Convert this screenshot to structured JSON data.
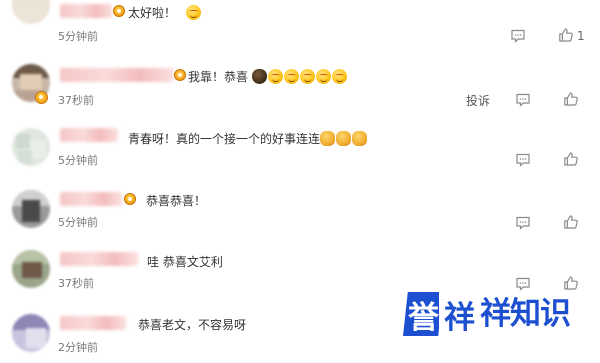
{
  "comments": [
    {
      "text": "太好啦！",
      "emojis": [
        "starstruck"
      ],
      "time": "5分钟前",
      "like_count": "1",
      "show_report": false
    },
    {
      "text": "我靠！恭喜",
      "emojis": [
        "dark",
        "starstruck",
        "starstruck",
        "starstruck",
        "starstruck",
        "starstruck"
      ],
      "time": "37秒前",
      "like_count": "",
      "show_report": true
    },
    {
      "text": "青春呀！真的一个接一个的好事连连",
      "emojis": [
        "clap",
        "clap",
        "clap"
      ],
      "time": "5分钟前",
      "like_count": "",
      "show_report": false
    },
    {
      "text": "恭喜恭喜！",
      "emojis": [],
      "time": "5分钟前",
      "like_count": "",
      "show_report": false
    },
    {
      "text": "哇 恭喜文艾利",
      "emojis": [],
      "time": "37秒前",
      "like_count": "",
      "show_report": false
    },
    {
      "text": "恭喜老文，不容易呀",
      "emojis": [],
      "time": "2分钟前",
      "like_count": "",
      "show_report": false
    }
  ],
  "labels": {
    "report": "投诉",
    "comment_icon": "comment-icon",
    "like_icon": "thumbs-up-icon",
    "vip_icon": "vip-badge-icon"
  },
  "watermark": {
    "char1": "誉",
    "char2": "祥",
    "rest": "祥知识",
    "color": "#1d4fd1"
  }
}
